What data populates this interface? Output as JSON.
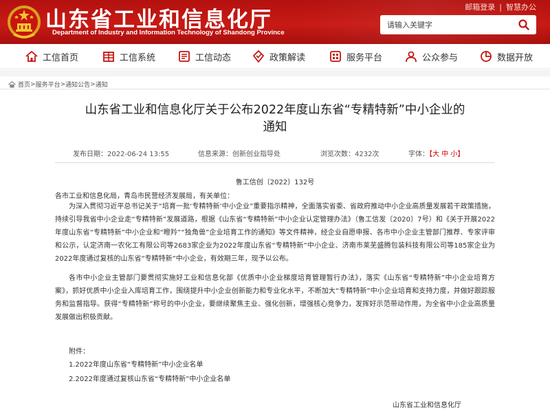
{
  "header": {
    "title": "山东省工业和信息化厅",
    "subtitle": "Department of Industry and Information Technology of Shandong Province",
    "top_links": [
      "邮箱登录",
      "智慧办公"
    ],
    "search_placeholder": "请输入关键字",
    "brand_color": "#c1140f"
  },
  "nav": {
    "items": [
      {
        "label": "工信首页",
        "icon": "home-icon"
      },
      {
        "label": "工信系统",
        "icon": "building-icon"
      },
      {
        "label": "工信动态",
        "icon": "news-icon"
      },
      {
        "label": "政策解读",
        "icon": "policy-icon"
      },
      {
        "label": "服务平台",
        "icon": "service-icon"
      },
      {
        "label": "公众参与",
        "icon": "people-icon"
      },
      {
        "label": "数据开放",
        "icon": "data-icon"
      }
    ]
  },
  "breadcrumb": {
    "items": [
      "首页",
      "服务平台",
      "通知公告",
      "通知"
    ],
    "separator": ">"
  },
  "article": {
    "title_line1": "山东省工业和信息化厅关于公布2022年度山东省“专精特新”中小企业的",
    "title_line2": "通知",
    "meta": {
      "date": "发布日期：2022-06-24 13:55",
      "source": "信息来源：创新创业指导处",
      "views": "浏览次数：4232次",
      "font_label": "字体：",
      "font_sizes": "【大 中 小】"
    },
    "doc_number": "鲁工信创〔2022〕132号",
    "addressee": "各市工业和信息化局，青岛市民营经济发展局，有关单位：",
    "paragraph1": "为深入贯彻习近平总书记关于“培育一批‘专精特新’中小企业”重要指示精神，全面落实省委、省政府推动中小企业高质量发展若干政策措施，持续引导我省中小企业走“专精特新”发展道路，根据《山东省“专精特新”中小企业认定管理办法》（鲁工信发〔2020〕7号）和《关于开展2022年度山东省“专精特新”中小企业和“瞪羚”“独角兽”企业培育工作的通知》等文件精神，经企业自愿申报、各市中小企业主管部门推荐、专家评审和公示，认定济南一农化工有限公司等2683家企业为2022年度山东省“专精特新”中小企业、济南市莱芜盛腾包装科技有限公司等185家企业为2022年度通过复核的山东省“专精特新”中小企业，有效期三年，现予以公布。",
    "paragraph2": "各市中小企业主管部门要贯彻实施好工业和信息化部《优质中小企业梯度培育管理暂行办法》，落实《山东省“专精特新”中小企业培育方案》，抓好优质中小企业入库培育工作，围绕提升中小企业创新能力和专业化水平，不断加大“专精特新”中小企业培育和支持力度，并做好跟踪服务和监督指导。获得“专精特新”称号的中小企业，要继续聚焦主业、强化创新，增强核心竞争力，发挥好示范带动作用，为全省中小企业高质量发展做出积极贡献。",
    "attachments_label": "附件：",
    "attachments": [
      "1.2022年度山东省“专精特新”中小企业名单",
      "2.2022年度通过复核山东省“专精特新”中小企业名单"
    ],
    "signature": "山东省工业和信息化厅"
  }
}
